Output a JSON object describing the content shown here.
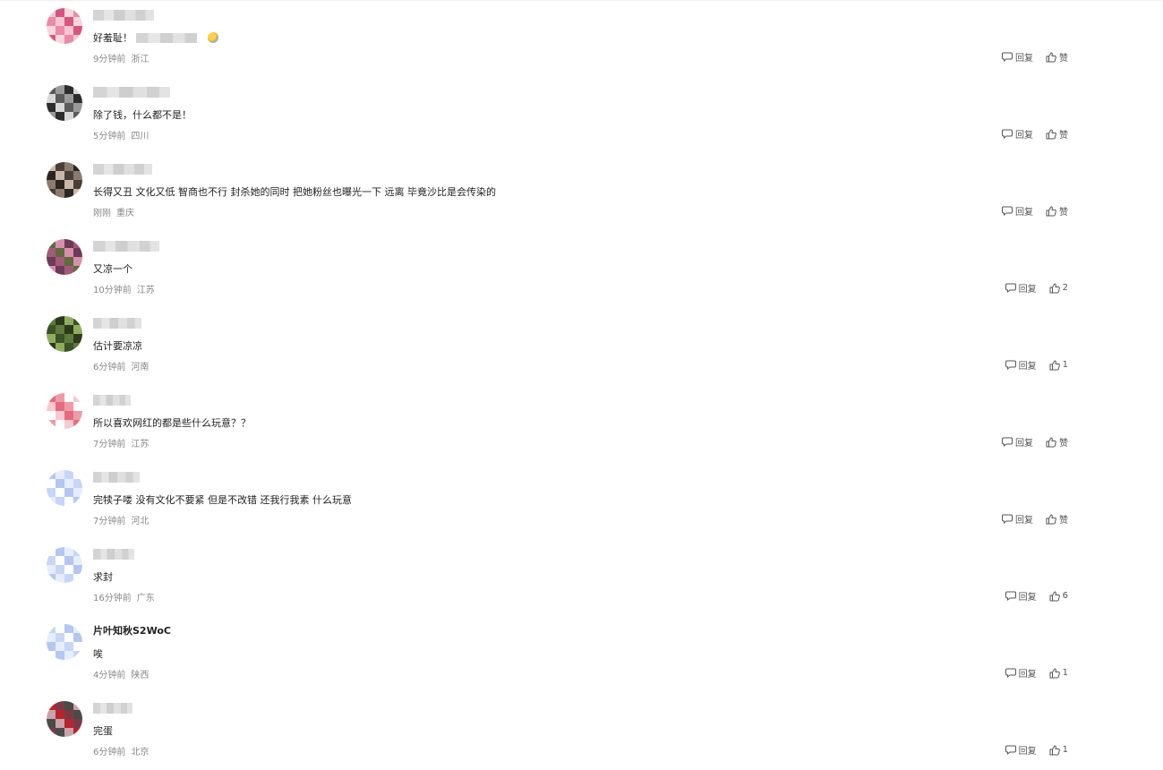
{
  "comments": [
    {
      "username": "",
      "content": "好羞耻！",
      "has_blurred_text": true,
      "has_emoji": true,
      "time": "9分钟前",
      "location": "浙江",
      "reply_label": "回复",
      "like_label": "赞",
      "avatar_colors": [
        "#f4c6d4",
        "#e98aa7",
        "#f7d6e0",
        "#d9557f"
      ]
    },
    {
      "username": "",
      "content": "除了钱，什么都不是！",
      "time": "5分钟前",
      "location": "四川",
      "reply_label": "回复",
      "like_label": "赞",
      "avatar_colors": [
        "#9a9a9a",
        "#5b5b5b",
        "#d8d8d8",
        "#2d2d2d"
      ]
    },
    {
      "username": "",
      "content": "长得又丑 文化又低 智商也不行 封杀她的同时 把她粉丝也曝光一下 远离 毕竟沙比是会传染的",
      "time": "刚刚",
      "location": "重庆",
      "reply_label": "回复",
      "like_label": "赞",
      "avatar_colors": [
        "#8c7b6d",
        "#4a3f38",
        "#c9b8a8",
        "#2b2622"
      ]
    },
    {
      "username": "",
      "content": "又凉一个",
      "time": "10分钟前",
      "location": "江苏",
      "reply_label": "回复",
      "like_label": "2",
      "avatar_colors": [
        "#a35a7a",
        "#6e3a58",
        "#d88fab",
        "#5f6b3e"
      ]
    },
    {
      "username": "",
      "content": "估计要凉凉",
      "time": "6分钟前",
      "location": "河南",
      "reply_label": "回复",
      "like_label": "1",
      "avatar_colors": [
        "#5e7a3c",
        "#3b5225",
        "#8fae5d",
        "#2a3a1a"
      ]
    },
    {
      "username": "",
      "content": "所以喜欢网红的都是些什么玩意？？",
      "time": "7分钟前",
      "location": "江苏",
      "reply_label": "回复",
      "like_label": "赞",
      "avatar_colors": [
        "#f09aa8",
        "#e66b80",
        "#f8c9d1",
        "#ffffff"
      ]
    },
    {
      "username": "",
      "content": "完犊子喽 没有文化不要紧 但是不改错 还我行我素 什么玩意",
      "time": "7分钟前",
      "location": "河北",
      "reply_label": "回复",
      "like_label": "赞",
      "avatar_colors": [
        "#c7d6f7",
        "#e6edfc",
        "#b3c7f2",
        "#ffffff"
      ]
    },
    {
      "username": "",
      "content": "求封",
      "time": "16分钟前",
      "location": "广东",
      "reply_label": "回复",
      "like_label": "6",
      "avatar_colors": [
        "#c7d6f7",
        "#e6edfc",
        "#b3c7f2",
        "#ffffff"
      ]
    },
    {
      "username": "片叶知秋S2WoC",
      "content": "唉",
      "time": "4分钟前",
      "location": "陕西",
      "reply_label": "回复",
      "like_label": "1",
      "avatar_colors": [
        "#c7d6f7",
        "#e6edfc",
        "#b3c7f2",
        "#ffffff"
      ]
    },
    {
      "username": "",
      "content": "完蛋",
      "time": "6分钟前",
      "location": "北京",
      "reply_label": "回复",
      "like_label": "1",
      "avatar_colors": [
        "#7a3a44",
        "#b8232f",
        "#c9a3a8",
        "#4a4a4a"
      ]
    }
  ]
}
